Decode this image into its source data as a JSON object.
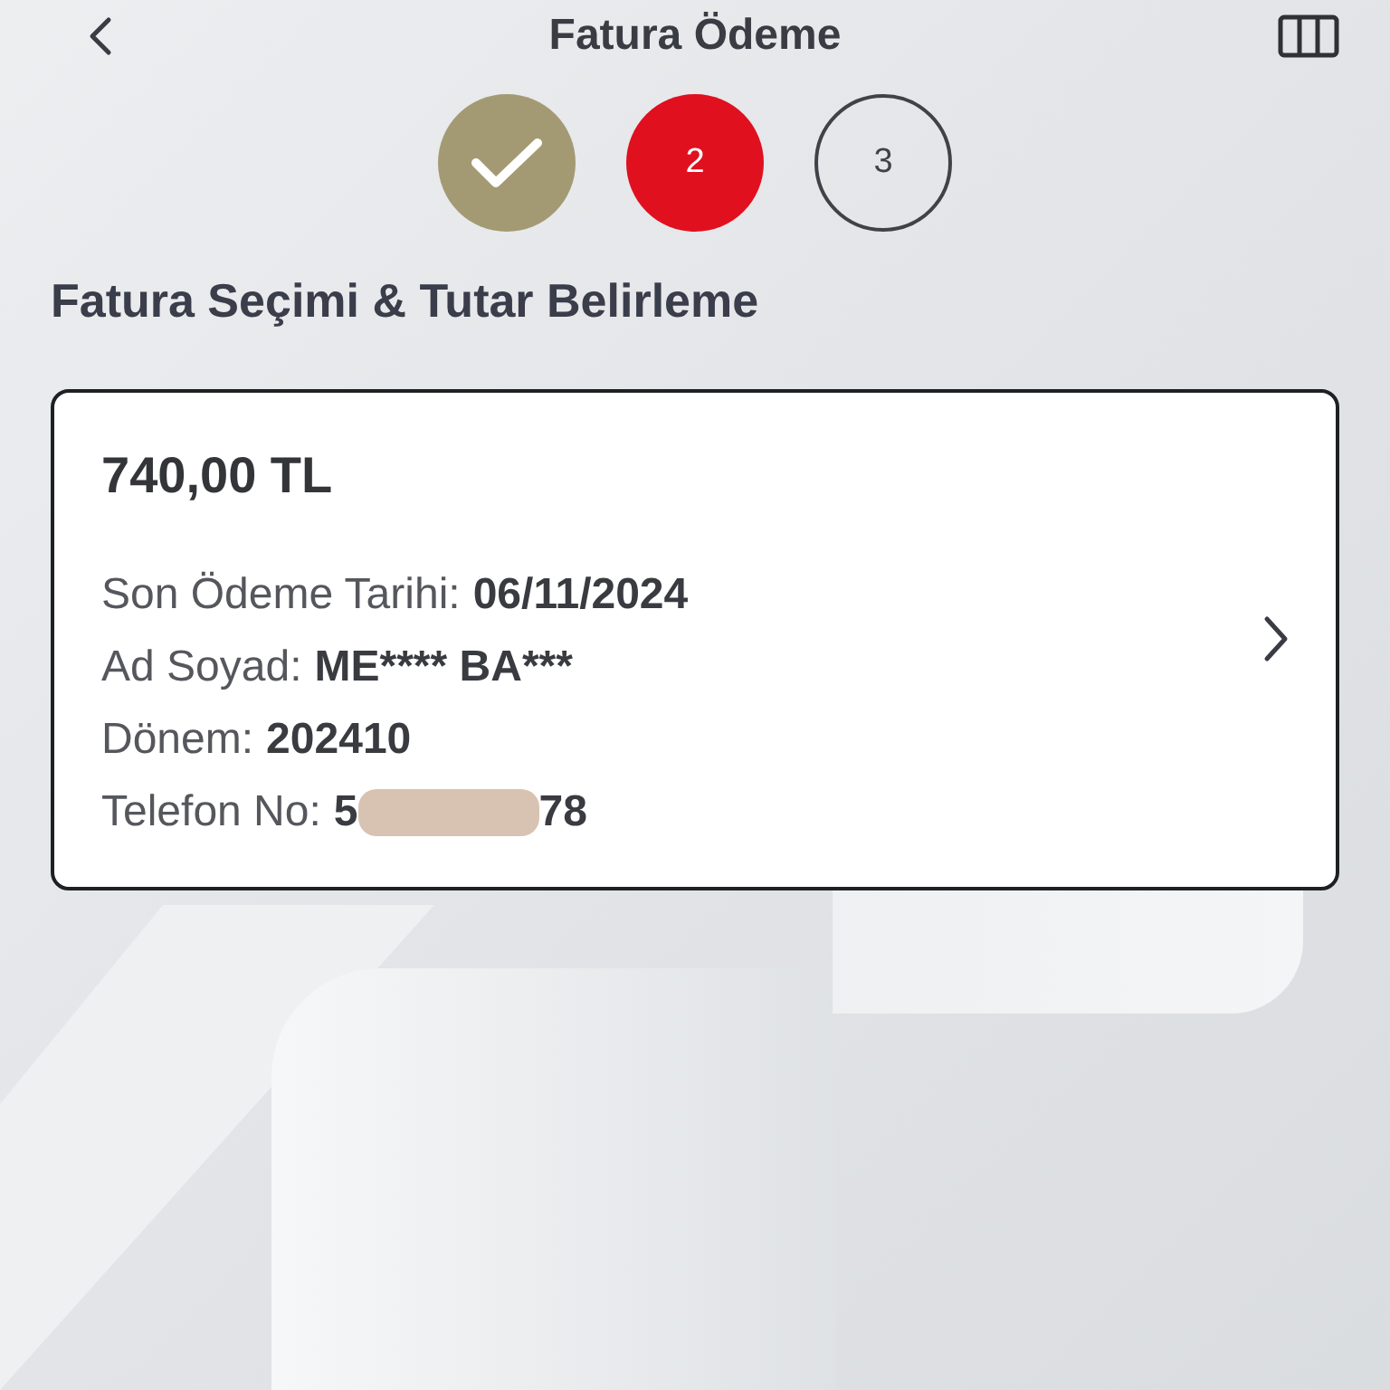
{
  "header": {
    "title": "Fatura Ödeme"
  },
  "steps": [
    {
      "completed": true,
      "selected": false
    },
    {
      "completed": false,
      "selected": true,
      "label": "2"
    },
    {
      "completed": false,
      "selected": false,
      "label": "3"
    }
  ],
  "section_title": "Fatura Seçimi & Tutar Belirleme",
  "bill": {
    "amount": "740,00 TL",
    "fields": [
      {
        "label": "Son Ödeme Tarihi:",
        "value": "06/11/2024",
        "redacted": false
      },
      {
        "label": "Ad Soyad:",
        "value": "ME**** BA***",
        "redacted": false
      },
      {
        "label": "Dönem:",
        "value": "202410",
        "redacted": false
      },
      {
        "label": "Telefon No:",
        "value": "5",
        "redacted": true,
        "value_end": "78"
      }
    ]
  }
}
